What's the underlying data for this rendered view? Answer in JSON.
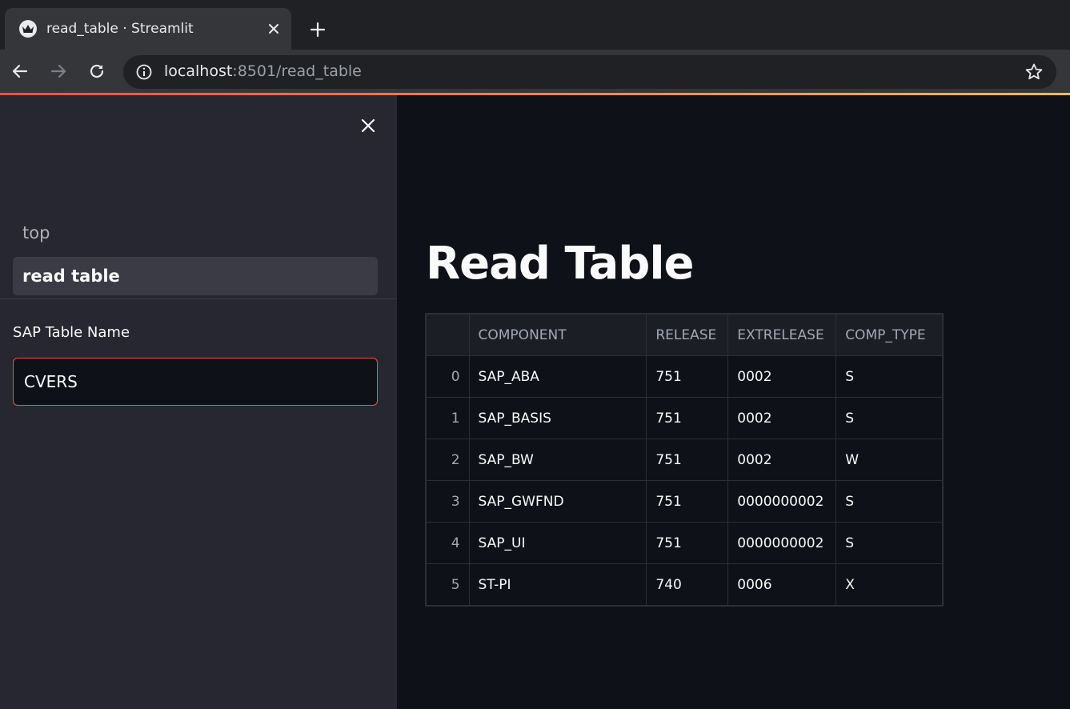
{
  "browser": {
    "tab_title": "read_table · Streamlit",
    "url_host": "localhost",
    "url_rest": ":8501/read_table"
  },
  "sidebar": {
    "nav": [
      {
        "label": "top",
        "active": false
      },
      {
        "label": "read table",
        "active": true
      }
    ],
    "field_label": "SAP Table Name",
    "field_value": "CVERS"
  },
  "main": {
    "title": "Read Table",
    "table": {
      "columns": [
        "",
        "COMPONENT",
        "RELEASE",
        "EXTRELEASE",
        "COMP_TYPE"
      ],
      "rows": [
        [
          "0",
          "SAP_ABA",
          "751",
          "0002",
          "S"
        ],
        [
          "1",
          "SAP_BASIS",
          "751",
          "0002",
          "S"
        ],
        [
          "2",
          "SAP_BW",
          "751",
          "0002",
          "W"
        ],
        [
          "3",
          "SAP_GWFND",
          "751",
          "0000000002",
          "S"
        ],
        [
          "4",
          "SAP_UI",
          "751",
          "0000000002",
          "S"
        ],
        [
          "5",
          "ST-PI",
          "740",
          "0006",
          "X"
        ]
      ]
    }
  },
  "colors": {
    "accent": "#ff4b4b",
    "background": "#0e1117",
    "sidebar": "#262730"
  },
  "icons": [
    "streamlit-crown-icon",
    "close-icon",
    "plus-icon",
    "arrow-left-icon",
    "arrow-right-icon",
    "reload-icon",
    "info-icon",
    "star-icon"
  ]
}
